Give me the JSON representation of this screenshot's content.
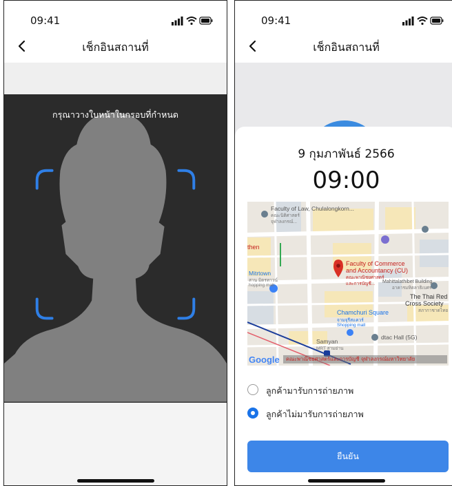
{
  "colors": {
    "accent": "#3d86e8",
    "camera_background": "#2b2b2b",
    "frame_corner": "#2f7fe6",
    "silhouette": "#808080"
  },
  "status_bar": {
    "time": "09:41",
    "icons": [
      "signal-icon",
      "wifi-icon",
      "battery-icon"
    ]
  },
  "header": {
    "title": "เช็กอินสถานที่",
    "back_icon": "chevron-left-icon"
  },
  "camera_screen": {
    "instruction": "กรุณาวางใบหน้าในกรอบที่กำหนด"
  },
  "checkin_sheet": {
    "date": "9 กุมภาพันธ์ 2566",
    "time": "09:00",
    "map": {
      "labels": {
        "faculty_of_law": "Faculty of Law, Chulalongkorn...",
        "faculty_of_law_thai": "คณะนิติศาสตร์ จุฬาลงกรณ์...",
        "then": "then",
        "mitrtown": "Mitrtown",
        "mitrtown_thai": "สาน มิตรทาวน์",
        "mitrtown_sub": "hopping mall",
        "commerce_line1": "Faculty of Commerce",
        "commerce_line2": "and Accountancy (CU)",
        "commerce_thai": "คณะพาณิชยศาสตร์และการบัญชี...",
        "mahittalathibet": "Mahittalathibet Building",
        "mahittalathibet_thai": "อาคารมหิตลาธิเบศร",
        "red_cross_line1": "The Thai Red",
        "red_cross_line2": "Cross Society",
        "red_cross_thai": "สภากาชาดไทย",
        "chamchuri": "Chamchuri Square",
        "chamchuri_thai": "จามจุรีสแควร์",
        "chamchuri_sub": "Shopping mall",
        "samyan": "Samyan",
        "samyan_sub": "MRT สามย่าน",
        "dtac": "dtac Hall (5G)",
        "google": "Google",
        "copyright": "คณะพาณิชยศาสตร์และการบัญชี จุฬาลงกรณ์มหาวิทยาลัย"
      }
    },
    "options": [
      {
        "label": "ลูกค้ามารับการถ่ายภาพ",
        "selected": false
      },
      {
        "label": "ลูกค้าไม่มารับการถ่ายภาพ",
        "selected": true
      }
    ],
    "confirm_label": "ยืนยัน"
  }
}
